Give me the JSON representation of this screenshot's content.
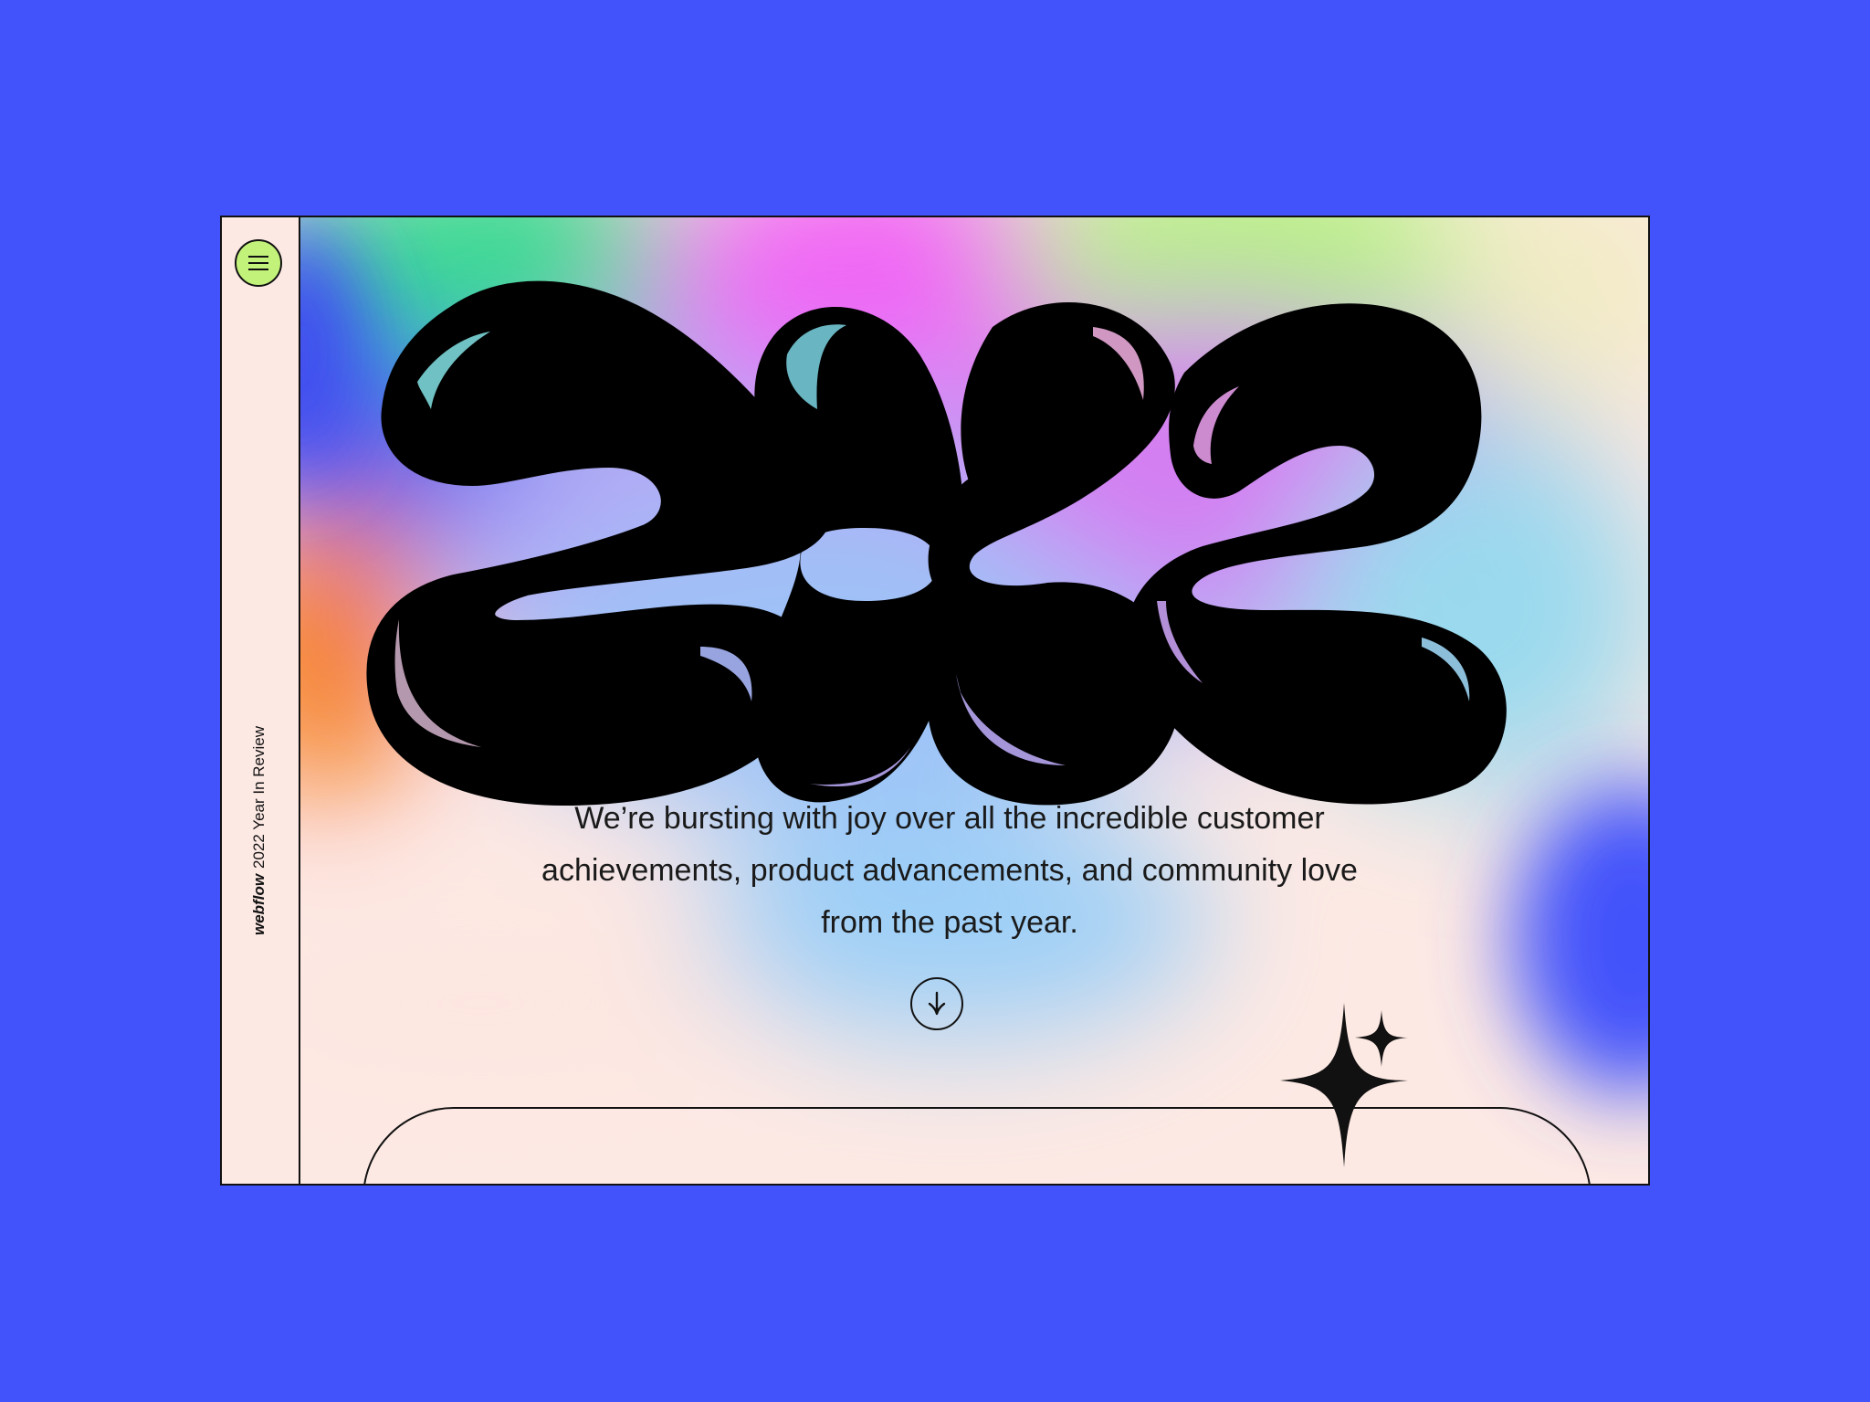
{
  "sidebar": {
    "brand": "webflow",
    "title": "2022 Year In Review",
    "menu_icon": "hamburger-menu-icon"
  },
  "hero": {
    "year": "2022",
    "intro": "We’re bursting with joy over all the incredible customer achievements, product advancements, and community love from the past year.",
    "scroll_icon": "arrow-down-icon",
    "sparkle_icon": "sparkle-icon"
  },
  "colors": {
    "page_bg": "#4353fb",
    "panel_bg": "#fde9e4",
    "menu_button": "#c2f27a",
    "ink": "#111111"
  }
}
